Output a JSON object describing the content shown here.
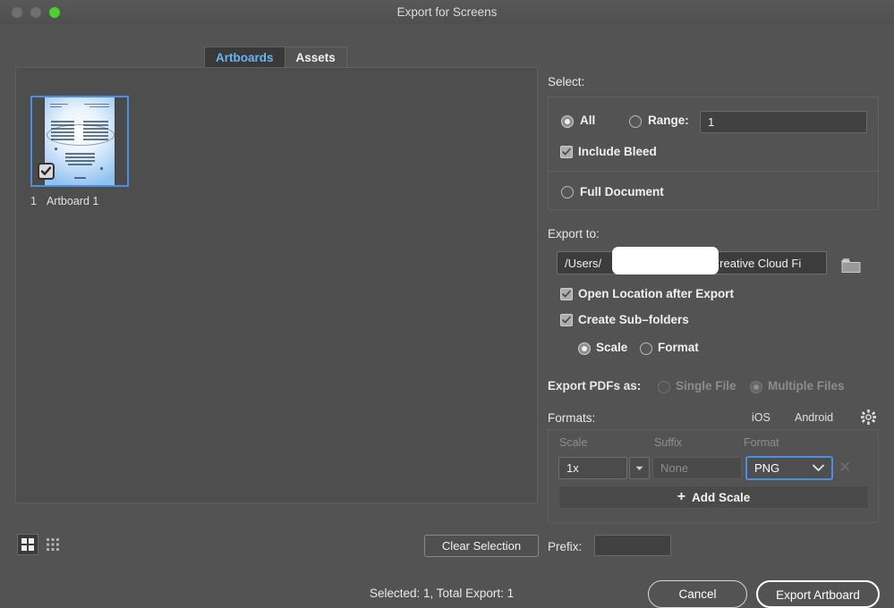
{
  "window": {
    "title": "Export for Screens",
    "traffic_lights": [
      "close",
      "minimize",
      "zoom"
    ]
  },
  "tabs": [
    {
      "label": "Artboards",
      "active": true
    },
    {
      "label": "Assets",
      "active": false
    }
  ],
  "artboards": {
    "items": [
      {
        "number": "1",
        "name": "Artboard 1",
        "checked": true,
        "selected": true
      }
    ],
    "view_modes": [
      {
        "name": "grid-view",
        "active": true
      },
      {
        "name": "list-view",
        "active": false
      }
    ],
    "clear_selection_label": "Clear Selection"
  },
  "select": {
    "label": "Select:",
    "all_label": "All",
    "all_selected": true,
    "range_label": "Range:",
    "range_selected": false,
    "range_value": "1",
    "include_bleed_label": "Include Bleed",
    "include_bleed_checked": true,
    "full_document_label": "Full Document",
    "full_document_selected": false
  },
  "export_to": {
    "label": "Export to:",
    "path_value": "/Users/",
    "path_value_tail": "/Creative Cloud Fi",
    "path_redacted": true,
    "folder_icon": "folder-icon",
    "open_location_label": "Open Location after Export",
    "open_location_checked": true,
    "create_subfolders_label": "Create Sub–folders",
    "create_subfolders_checked": true,
    "subfolder_mode": [
      {
        "label": "Scale",
        "selected": true
      },
      {
        "label": "Format",
        "selected": false
      }
    ]
  },
  "export_pdfs": {
    "label": "Export PDFs as:",
    "options": [
      {
        "label": "Single File",
        "selected": false,
        "disabled": true
      },
      {
        "label": "Multiple Files",
        "selected": true,
        "disabled": true
      }
    ]
  },
  "formats": {
    "label": "Formats:",
    "presets": [
      {
        "label": "iOS"
      },
      {
        "label": "Android"
      }
    ],
    "settings_icon": "gear-icon",
    "columns": [
      "Scale",
      "Suffix",
      "Format"
    ],
    "rows": [
      {
        "scale": "1x",
        "suffix_placeholder": "None",
        "format": "PNG",
        "remove_icon": "close-icon"
      }
    ],
    "add_scale_label": "Add Scale",
    "add_scale_plus": "+"
  },
  "prefix": {
    "label": "Prefix:",
    "value": ""
  },
  "footer": {
    "status": "Selected: 1, Total Export: 1",
    "cancel_label": "Cancel",
    "export_label": "Export Artboard"
  },
  "colors": {
    "window_bg": "#535353",
    "panel_bg": "#4e4e4e",
    "accent_blue": "#4a90e2",
    "tab_active_text": "#6cb4f0",
    "zoom_green": "#4bd22e",
    "text": "#f0f0f0",
    "text_dim": "#8c8c8c"
  }
}
